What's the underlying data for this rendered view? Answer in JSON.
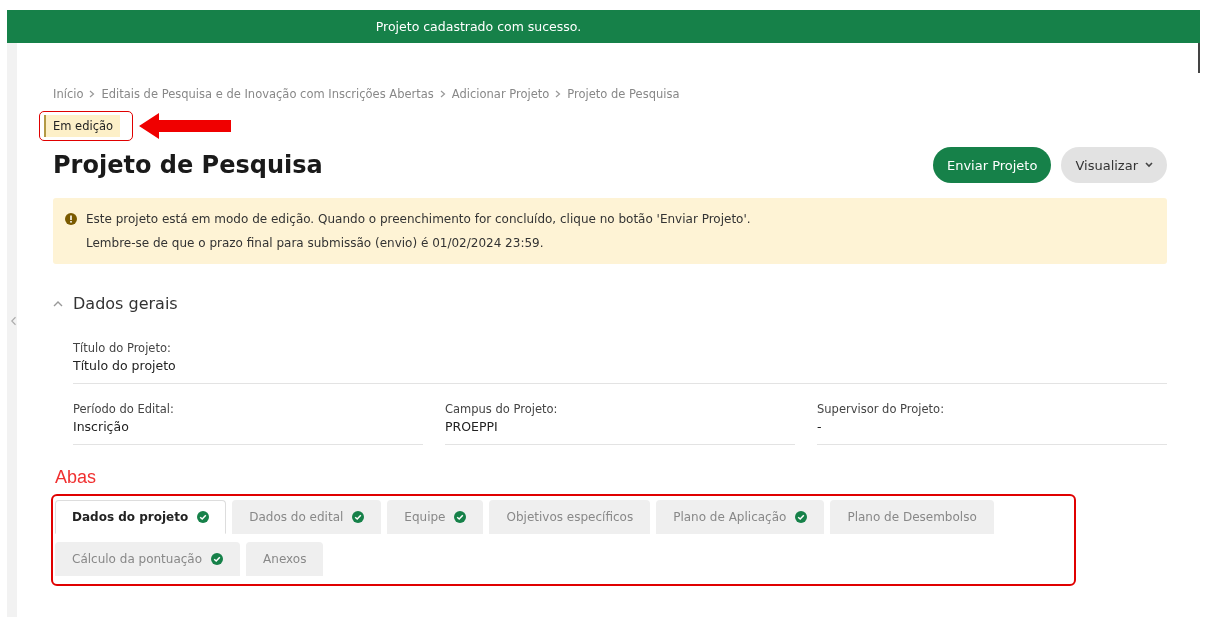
{
  "toast": {
    "message": "Projeto cadastrado com sucesso."
  },
  "breadcrumb": [
    "Início",
    "Editais de Pesquisa e de Inovação com Inscrições Abertas",
    "Adicionar Projeto",
    "Projeto de Pesquisa"
  ],
  "status_badge": {
    "label": "Em edição"
  },
  "title": "Projeto de Pesquisa",
  "actions": [
    {
      "label": "Enviar Projeto",
      "kind": "primary"
    },
    {
      "label": "Visualizar",
      "kind": "dropdown"
    }
  ],
  "alert": {
    "lines": [
      "Este projeto está em modo de edição. Quando o preenchimento for concluído, clique no botão 'Enviar Projeto'.",
      "Lembre-se de que o prazo final para submissão (envio) é 01/02/2024 23:59."
    ]
  },
  "section": {
    "title": "Dados gerais",
    "expanded": true
  },
  "field_rows": [
    [
      {
        "label": "Título do Projeto:",
        "value": "Título do projeto"
      }
    ],
    [
      {
        "label": "Período do Edital:",
        "value": "Inscrição"
      },
      {
        "label": "Campus do Projeto:",
        "value": "PROEPPI"
      },
      {
        "label": "Supervisor do Projeto:",
        "value": "-"
      }
    ]
  ],
  "annotation": {
    "label": "Abas"
  },
  "tabs": [
    {
      "label": "Dados do projeto",
      "selected": true,
      "complete": true
    },
    {
      "label": "Dados do edital",
      "selected": false,
      "complete": true
    },
    {
      "label": "Equipe",
      "selected": false,
      "complete": true
    },
    {
      "label": "Objetivos específicos",
      "selected": false,
      "complete": false
    },
    {
      "label": "Plano de Aplicação",
      "selected": false,
      "complete": true
    },
    {
      "label": "Plano de Desembolso",
      "selected": false,
      "complete": false
    },
    {
      "label": "Cálculo da pontuação",
      "selected": false,
      "complete": true
    },
    {
      "label": "Anexos",
      "selected": false,
      "complete": false
    }
  ]
}
